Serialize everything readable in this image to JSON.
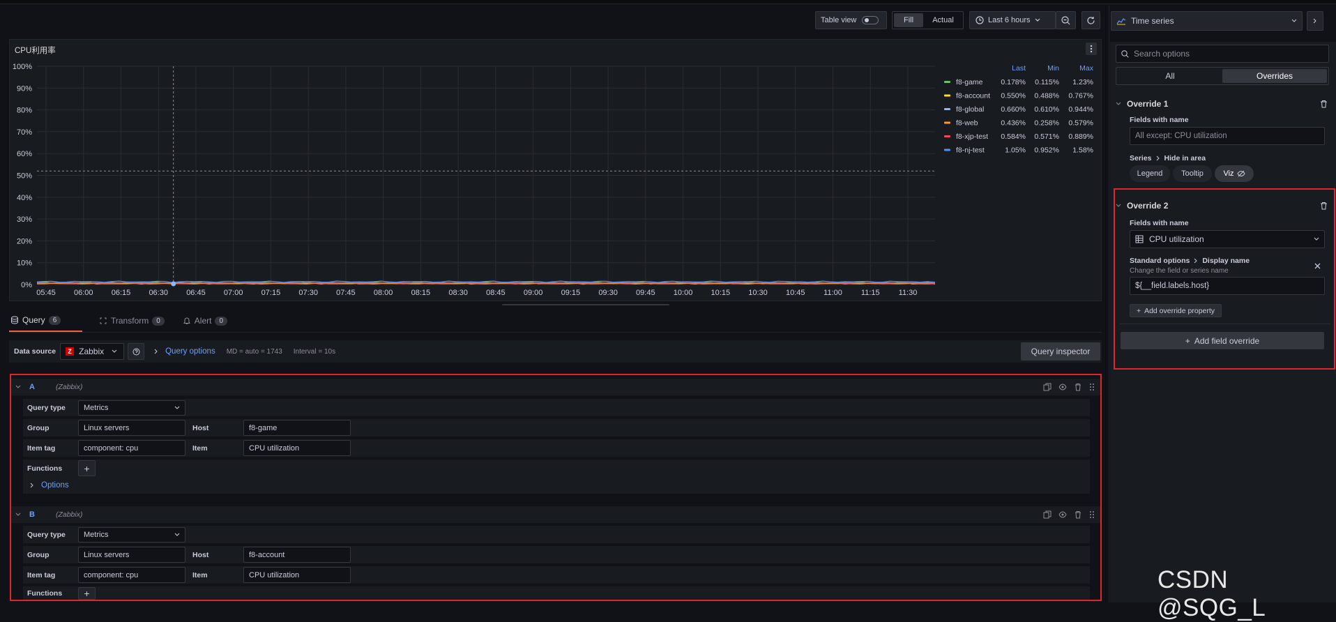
{
  "toolbar": {
    "table_view": "Table view",
    "fill": "Fill",
    "actual": "Actual",
    "time_range": "Last 6 hours"
  },
  "panel": {
    "title": "CPU利用率"
  },
  "chart_data": {
    "type": "line",
    "title": "CPU利用率",
    "ylim": [
      0,
      100
    ],
    "y_ticks": [
      "100%",
      "90%",
      "80%",
      "70%",
      "60%",
      "50%",
      "40%",
      "30%",
      "20%",
      "10%",
      "0%"
    ],
    "x_ticks": [
      "05:45",
      "06:00",
      "06:15",
      "06:30",
      "06:45",
      "07:00",
      "07:15",
      "07:30",
      "07:45",
      "08:00",
      "08:15",
      "08:30",
      "08:45",
      "09:00",
      "09:15",
      "09:30",
      "09:45",
      "10:00",
      "10:15",
      "10:30",
      "10:45",
      "11:00",
      "11:15",
      "11:30"
    ],
    "threshold": 52,
    "legend_headers": [
      "Last",
      "Min",
      "Max"
    ],
    "series": [
      {
        "name": "f8-game",
        "color": "#73bf69",
        "last": "0.178%",
        "min": "0.115%",
        "max": "1.23%"
      },
      {
        "name": "f8-account",
        "color": "#fade2a",
        "last": "0.550%",
        "min": "0.488%",
        "max": "0.767%"
      },
      {
        "name": "f8-global",
        "color": "#8ab8ff",
        "last": "0.660%",
        "min": "0.610%",
        "max": "0.944%"
      },
      {
        "name": "f8-web",
        "color": "#ff9830",
        "last": "0.436%",
        "min": "0.258%",
        "max": "0.579%"
      },
      {
        "name": "f8-xjp-test",
        "color": "#f2495c",
        "last": "0.584%",
        "min": "0.571%",
        "max": "0.889%"
      },
      {
        "name": "f8-nj-test",
        "color": "#5794f2",
        "last": "1.05%",
        "min": "0.952%",
        "max": "1.58%"
      }
    ]
  },
  "tabs": [
    {
      "label": "Query",
      "count": "6"
    },
    {
      "label": "Transform",
      "count": "0"
    },
    {
      "label": "Alert",
      "count": "0"
    }
  ],
  "datasource": {
    "label": "Data source",
    "name": "Zabbix",
    "query_options": "Query options",
    "md": "MD = auto = 1743",
    "interval": "Interval = 10s",
    "inspector": "Query inspector"
  },
  "queries": [
    {
      "ref": "A",
      "source": "(Zabbix)",
      "query_type_label": "Query type",
      "query_type": "Metrics",
      "group_label": "Group",
      "group": "Linux servers",
      "host_label": "Host",
      "host": "f8-game",
      "tag_label": "Item tag",
      "tag": "component: cpu",
      "item_label": "Item",
      "item": "CPU utilization",
      "functions_label": "Functions",
      "options_label": "Options"
    },
    {
      "ref": "B",
      "source": "(Zabbix)",
      "query_type_label": "Query type",
      "query_type": "Metrics",
      "group_label": "Group",
      "group": "Linux servers",
      "host_label": "Host",
      "host": "f8-account",
      "tag_label": "Item tag",
      "tag": "component: cpu",
      "item_label": "Item",
      "item": "CPU utilization",
      "functions_label": "Functions"
    }
  ],
  "sidebar": {
    "viz": "Time series",
    "search_placeholder": "Search options",
    "tab_all": "All",
    "tab_overrides": "Overrides",
    "override1": {
      "title": "Override 1",
      "fields_label": "Fields with name",
      "fields_value": "All except: CPU utilization",
      "series_path": "Series",
      "hide_label": "Hide in area",
      "legend": "Legend",
      "tooltip": "Tooltip",
      "viz": "Viz"
    },
    "override2": {
      "title": "Override 2",
      "fields_label": "Fields with name",
      "fields_value": "CPU utilization",
      "std_path": "Standard options",
      "display_name": "Display name",
      "desc": "Change the field or series name",
      "value": "${__field.labels.host}",
      "add_property": "Add override property"
    },
    "add_field_override": "Add field override"
  },
  "watermark": "CSDN @SQG_L",
  "colors": {
    "highlight": "#e0262b",
    "accent": "#6e9fff",
    "tab_active": "#f55f3e"
  }
}
